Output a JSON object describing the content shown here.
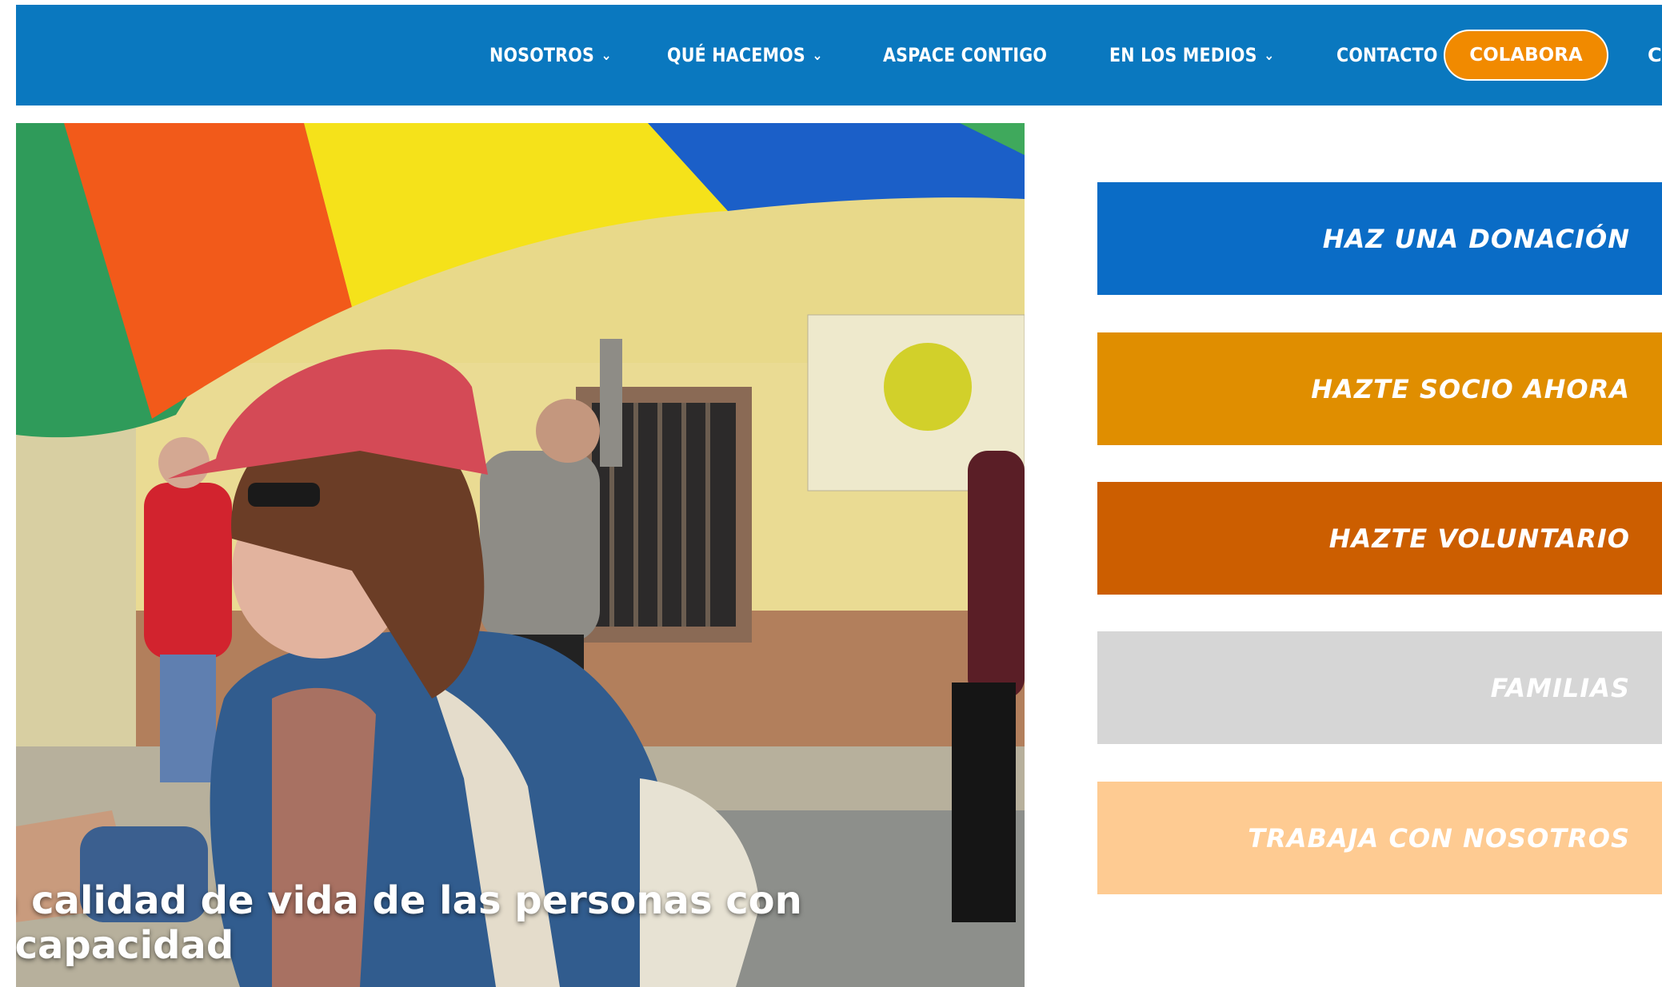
{
  "nav": {
    "items": [
      {
        "label": "NOSOTROS",
        "has_dropdown": true
      },
      {
        "label": "QUÉ HACEMOS",
        "has_dropdown": true
      },
      {
        "label": "ASPACE CONTIGO",
        "has_dropdown": false
      },
      {
        "label": "EN LOS MEDIOS",
        "has_dropdown": true
      },
      {
        "label": "CONTACTO",
        "has_dropdown": false
      }
    ],
    "cta_label": "COLABORA",
    "cut_off_label": "CA"
  },
  "hero": {
    "caption_line1": "a calidad de vida de las personas con",
    "caption_line2": "scapacidad"
  },
  "side_buttons": {
    "donate": "HAZ UNA DONACIÓN",
    "socio": "HAZTE SOCIO AHORA",
    "voluntario": "HAZTE VOLUNTARIO",
    "familias": "FAMILIAS",
    "trabaja": "TRABAJA CON NOSOTROS"
  },
  "colors": {
    "nav_bg": "#0a78bf",
    "cta_bg": "#f18a00",
    "donate_bg": "#0a6cc6",
    "socio_bg": "#e08e00",
    "voluntario_bg": "#cc5e00",
    "familias_bg": "#d6d6d6",
    "trabaja_bg": "#fecb92"
  }
}
